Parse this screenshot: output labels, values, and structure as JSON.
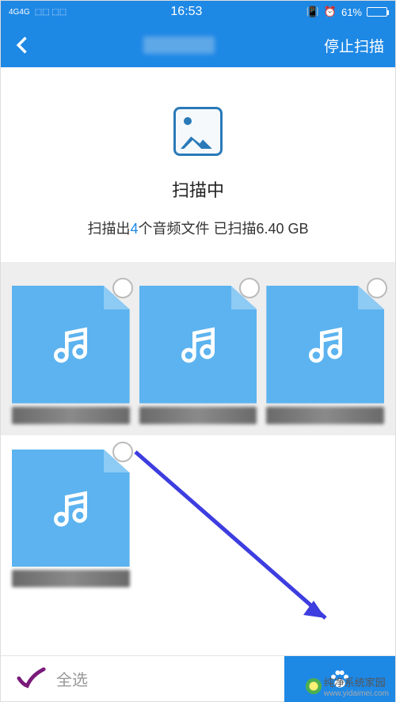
{
  "status": {
    "signal": "4G",
    "time": "16:53",
    "battery_pct": "61%"
  },
  "header": {
    "stop_label": "停止扫描"
  },
  "scan": {
    "title": "扫描中",
    "desc_prefix": "扫描出",
    "count": "4",
    "desc_mid": "个音频文件 已扫描",
    "size": "6.40 GB"
  },
  "files": [
    {
      "type": "audio"
    },
    {
      "type": "audio"
    },
    {
      "type": "audio"
    },
    {
      "type": "audio"
    }
  ],
  "bottom": {
    "select_all": "全选"
  },
  "watermark": {
    "text": "纯净系统家园",
    "url": "www.yidaimei.com"
  }
}
